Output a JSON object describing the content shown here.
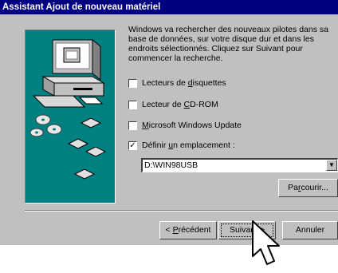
{
  "window": {
    "title": "Assistant Ajout de nouveau matériel"
  },
  "description": "Windows va rechercher des nouveaux pilotes dans sa base de données, sur votre disque dur et dans les endroits sélectionnés. Cliquez sur Suivant pour commencer la recherche.",
  "options": [
    {
      "pre": "Lecteurs de ",
      "key": "d",
      "post": "isquettes",
      "checked": false
    },
    {
      "pre": "Lecteur de ",
      "key": "C",
      "post": "D-ROM",
      "checked": false
    },
    {
      "pre": "",
      "key": "M",
      "post": "icrosoft Windows Update",
      "checked": false
    },
    {
      "pre": "Définir ",
      "key": "u",
      "post": "n emplacement :",
      "checked": true
    }
  ],
  "location": {
    "value": "D:\\WIN98USB"
  },
  "buttons": {
    "browse": {
      "pre": "Pa",
      "key": "r",
      "post": "courir..."
    },
    "back": {
      "pre": "< ",
      "key": "P",
      "post": "récédent"
    },
    "next": {
      "pre": "Suivant ",
      "key": "",
      "post": ">"
    },
    "cancel": {
      "pre": "Annuler",
      "key": "",
      "post": ""
    }
  },
  "icons": {
    "illustration": "computer-with-cds-and-diskettes",
    "pointer": "arrow-cursor",
    "dropdown": "chevron-down"
  },
  "colors": {
    "title_bar": "#000080",
    "dialog": "#c0c0c0",
    "illustration_bg": "#008080"
  }
}
